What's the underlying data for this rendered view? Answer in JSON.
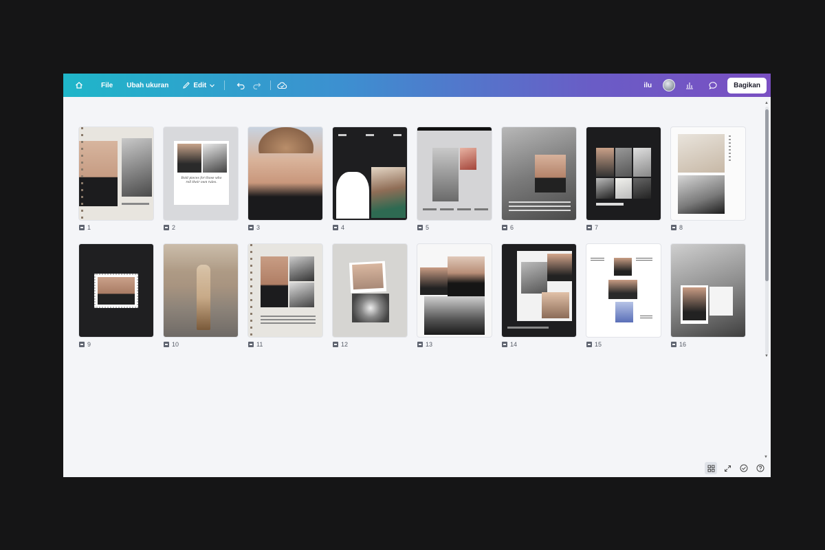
{
  "toolbar": {
    "home_icon": "home-icon",
    "file_label": "File",
    "resize_label": "Ubah ukuran",
    "edit_label": "Edit",
    "user_initials": "ilu",
    "share_label": "Bagikan"
  },
  "pages": [
    {
      "number": "1"
    },
    {
      "number": "2"
    },
    {
      "number": "3"
    },
    {
      "number": "4"
    },
    {
      "number": "5"
    },
    {
      "number": "6"
    },
    {
      "number": "7"
    },
    {
      "number": "8"
    },
    {
      "number": "9"
    },
    {
      "number": "10"
    },
    {
      "number": "11"
    },
    {
      "number": "12"
    },
    {
      "number": "13"
    },
    {
      "number": "14"
    },
    {
      "number": "15"
    },
    {
      "number": "16"
    }
  ],
  "page2_text": "Bold pieces for those who roll their own rules.",
  "colors": {
    "topbar_start": "#1fb6c9",
    "topbar_end": "#7a4fc2",
    "canvas_bg": "#f4f5f8",
    "outer_bg": "#151516"
  }
}
